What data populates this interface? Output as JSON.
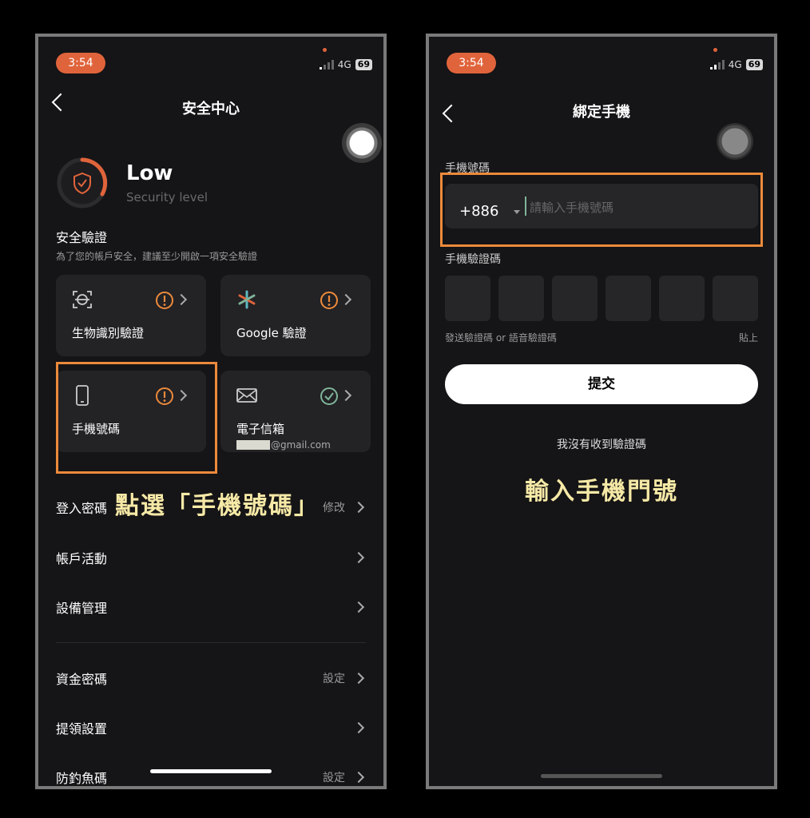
{
  "left": {
    "status": {
      "time": "3:54",
      "network": "4G",
      "battery": "69"
    },
    "title": "安全中心",
    "security": {
      "level": "Low",
      "level_caption": "Security level"
    },
    "section": {
      "title": "安全驗證",
      "desc": "為了您的帳戶安全，建議至少開啟一項安全驗證"
    },
    "cards": [
      {
        "label": "生物識別驗證",
        "icon": "face-scan-icon",
        "status": "warning"
      },
      {
        "label": "Google 驗證",
        "icon": "google-authenticator-icon",
        "status": "warning"
      },
      {
        "label": "手機號碼",
        "icon": "phone-icon",
        "status": "warning"
      },
      {
        "label": "電子信箱",
        "sub": "@gmail.com",
        "icon": "mail-icon",
        "status": "verified"
      }
    ],
    "caption": "點選「手機號碼」",
    "rows": [
      {
        "label": "登入密碼",
        "value": "修改"
      },
      {
        "label": "帳戶活動",
        "value": ""
      },
      {
        "label": "設備管理",
        "value": ""
      },
      {
        "label": "資金密碼",
        "value": "設定"
      },
      {
        "label": "提領設置",
        "value": ""
      },
      {
        "label": "防釣魚碼",
        "value": "設定"
      }
    ]
  },
  "right": {
    "status": {
      "time": "3:54",
      "network": "4G",
      "battery": "69"
    },
    "title": "綁定手機",
    "phone_label": "手機號碼",
    "country_code": "+886",
    "phone_placeholder": "請輸入手機號碼",
    "code_label": "手機驗證碼",
    "send_note": "發送驗證碼 or 語音驗證碼",
    "paste": "貼上",
    "submit": "提交",
    "no_code": "我沒有收到驗證碼",
    "caption": "輸入手機門號"
  },
  "colors": {
    "accent": "#e0643b",
    "highlight": "#ec8a3b",
    "caption": "#f6e9a6",
    "verified": "#7fb59a",
    "background": "#151416",
    "card": "#232225"
  }
}
